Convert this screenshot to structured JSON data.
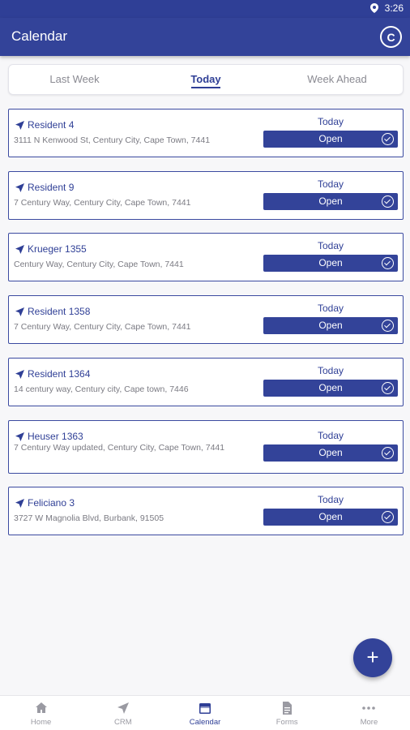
{
  "status_bar": {
    "time": "3:26"
  },
  "app_bar": {
    "title": "Calendar",
    "action_letter": "C"
  },
  "tabs": [
    {
      "label": "Last Week",
      "active": false
    },
    {
      "label": "Today",
      "active": true
    },
    {
      "label": "Week Ahead",
      "active": false
    }
  ],
  "appointments": [
    {
      "name": "Resident 4",
      "address": "3111 N Kenwood St, Century City, Cape Town, 7441",
      "day": "Today",
      "button": "Open"
    },
    {
      "name": "Resident 9",
      "address": "7 Century Way, Century City, Cape Town, 7441",
      "day": "Today",
      "button": "Open"
    },
    {
      "name": "Krueger 1355",
      "address": "Century Way, Century City, Cape Town, 7441",
      "day": "Today",
      "button": "Open"
    },
    {
      "name": "Resident 1358",
      "address": " 7 Century Way, Century City, Cape Town, 7441",
      "day": "Today",
      "button": "Open"
    },
    {
      "name": "Resident 1364",
      "address": "14 century way, Century city, Cape town, 7446",
      "day": "Today",
      "button": "Open"
    },
    {
      "name": "Heuser 1363",
      "address": " 7 Century Way updated, Century City, Cape Town, 7441",
      "day": "Today",
      "button": "Open"
    },
    {
      "name": "Feliciano 3",
      "address": "3727 W Magnolia Blvd, Burbank, 91505",
      "day": "Today",
      "button": "Open"
    }
  ],
  "fab": {
    "label": "+"
  },
  "bottom_nav": [
    {
      "label": "Home",
      "icon": "home-icon",
      "active": false
    },
    {
      "label": "CRM",
      "icon": "navigation-arrow-icon",
      "active": false
    },
    {
      "label": "Calendar",
      "icon": "calendar-icon",
      "active": true
    },
    {
      "label": "Forms",
      "icon": "document-icon",
      "active": false
    },
    {
      "label": "More",
      "icon": "more-dots-icon",
      "active": false
    }
  ],
  "colors": {
    "primary": "#334399",
    "status_bar": "#2f3f96",
    "background": "#f7f7f9"
  }
}
